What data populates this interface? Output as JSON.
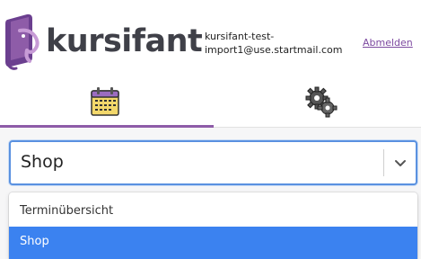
{
  "header": {
    "logo_text": "kursifant",
    "user_email": "kursifant-test-import1@use.startmail.com",
    "logout_label": "Abmelden"
  },
  "tabs": [
    {
      "icon": "calendar-icon",
      "active": true
    },
    {
      "icon": "gears-icon",
      "active": false
    }
  ],
  "select": {
    "selected_value": "Shop",
    "options": [
      "Terminübersicht",
      "Shop"
    ]
  },
  "colors": {
    "accent": "#8e5ca8",
    "focus_border": "#5a91e0",
    "selected_option": "#3b82f0",
    "logo_text": "#3f4048"
  }
}
